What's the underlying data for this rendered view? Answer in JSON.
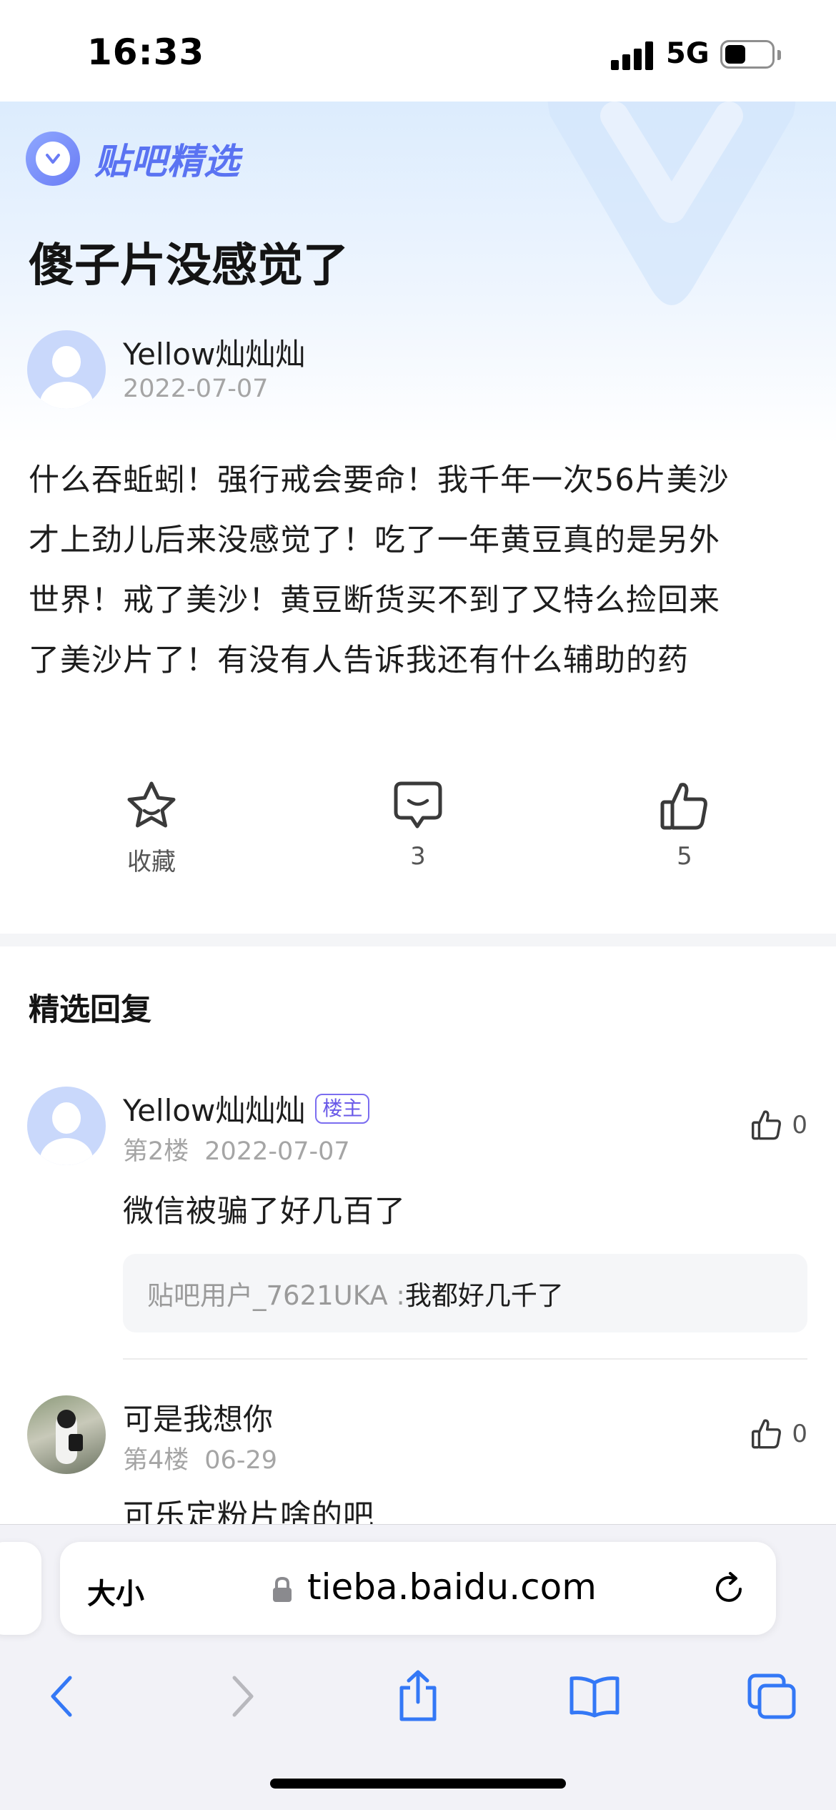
{
  "status_bar": {
    "time": "16:33",
    "network": "5G",
    "battery_level": 0.45
  },
  "brand": {
    "title": "贴吧精选"
  },
  "post": {
    "title": "傻子片没感觉了",
    "author": "Yellow灿灿灿",
    "date": "2022-07-07",
    "body_lines": [
      "什么吞蚯蚓！强行戒会要命！我千年一次56片美沙",
      "才上劲儿后来没感觉了！吃了一年黄豆真的是另外",
      "世界！戒了美沙！黄豆断货买不到了又特么捡回来",
      "了美沙片了！有没有人告诉我还有什么辅助的药"
    ]
  },
  "actions": {
    "favorite_label": "收藏",
    "comment_count": "3",
    "like_count": "5"
  },
  "section": {
    "title": "精选回复"
  },
  "replies": [
    {
      "author": "Yellow灿灿灿",
      "tag": "楼主",
      "floor": "第2楼",
      "date": "2022-07-07",
      "likes": "0",
      "text": "微信被骗了好几百了",
      "sub_user": "贴吧用户_7621UKA :",
      "sub_text": "我都好几千了"
    },
    {
      "author": "可是我想你",
      "floor": "第4楼",
      "date": "06-29",
      "likes": "0",
      "text": "可乐定粉片啥的吧"
    }
  ],
  "browser": {
    "text_size_label": "大小",
    "url": "tieba.baidu.com"
  },
  "icons": {
    "brand": "tieba-logo-icon",
    "favorite": "star-icon",
    "comment": "comment-icon",
    "like": "thumbs-up-icon",
    "lock": "lock-icon",
    "reload": "reload-icon",
    "back": "chevron-left-icon",
    "forward": "chevron-right-icon",
    "share": "share-icon",
    "bookmarks": "book-icon",
    "tabs": "tabs-icon"
  },
  "colors": {
    "accent": "#5a73f2",
    "tag": "#6a5ae8",
    "browser_tint": "#3478f6"
  }
}
